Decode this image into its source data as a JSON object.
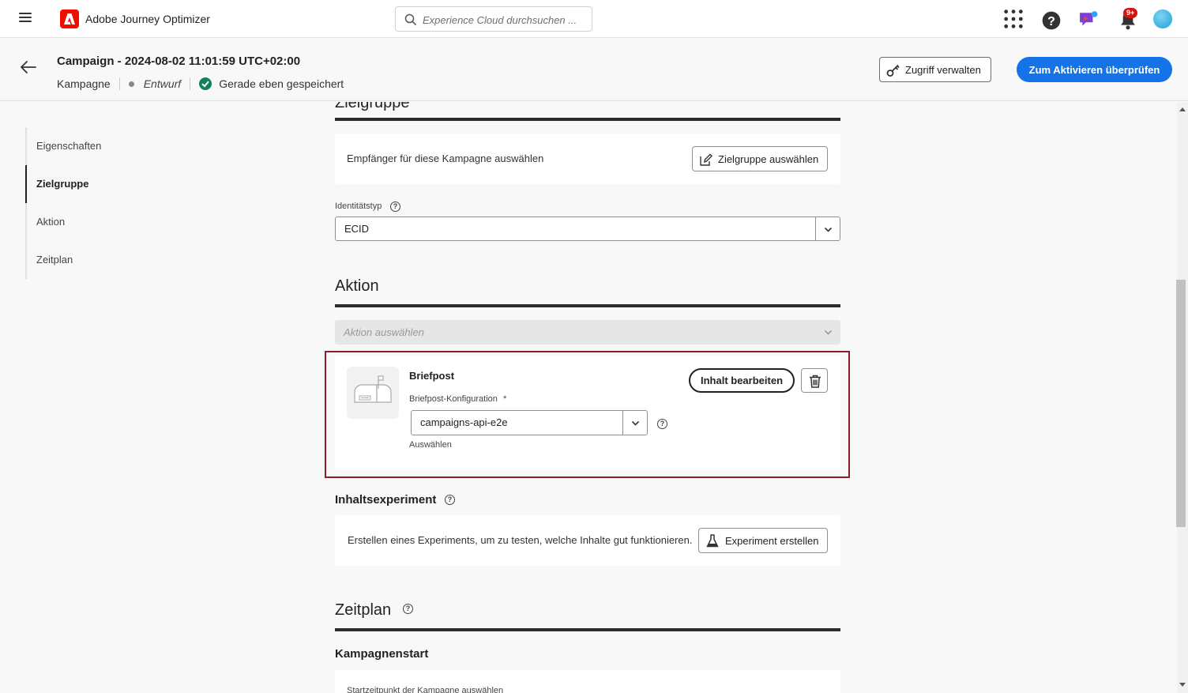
{
  "topbar": {
    "app_name": "Adobe Journey Optimizer",
    "search_placeholder": "Experience Cloud durchsuchen ...",
    "notifications_badge": "9+"
  },
  "header": {
    "title": "Campaign - 2024-08-02 11:01:59 UTC+02:00",
    "type": "Kampagne",
    "status": "Entwurf",
    "saved_status": "Gerade eben gespeichert",
    "manage_access_label": "Zugriff verwalten",
    "review_label": "Zum Aktivieren überprüfen"
  },
  "nav": {
    "items": [
      "Eigenschaften",
      "Zielgruppe",
      "Aktion",
      "Zeitplan"
    ],
    "active": "Zielgruppe"
  },
  "audience": {
    "heading": "Zielgruppe",
    "card_text": "Empfänger für diese Kampagne auswählen",
    "select_button": "Zielgruppe auswählen",
    "identity_label": "Identitätstyp",
    "identity_value": "ECID"
  },
  "action": {
    "heading": "Aktion",
    "select_placeholder": "Aktion auswählen",
    "channel_name": "Briefpost",
    "config_label": "Briefpost-Konfiguration",
    "required_mark": "*",
    "config_value": "campaigns-api-e2e",
    "config_help": "Auswählen",
    "edit_content_label": "Inhalt bearbeiten"
  },
  "experiment": {
    "heading": "Inhaltsexperiment",
    "card_text": "Erstellen eines Experiments, um zu testen, welche Inhalte gut funktionieren.",
    "button_label": "Experiment erstellen"
  },
  "schedule": {
    "heading": "Zeitplan",
    "subheading": "Kampagnenstart",
    "start_label": "Startzeitpunkt der Kampagne auswählen"
  },
  "colors": {
    "accent": "#1473e6",
    "highlight_border": "#8b1f24",
    "brand": "#eb1000"
  }
}
